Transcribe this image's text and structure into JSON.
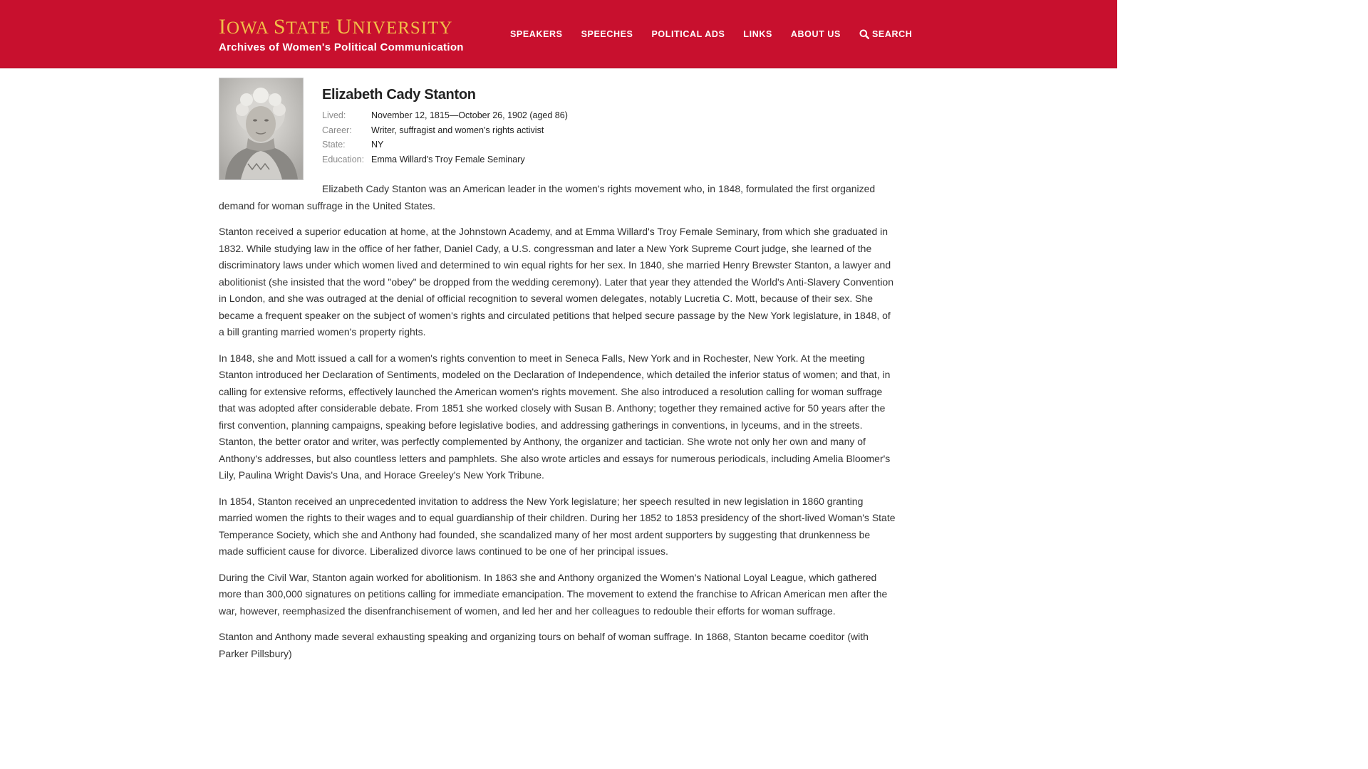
{
  "header": {
    "wordmark_i": "I",
    "wordmark_owa": "OWA",
    "wordmark_s": "S",
    "wordmark_tate": "TATE",
    "wordmark_u": "U",
    "wordmark_niversity": "NIVERSITY",
    "subtitle": "Archives of Women's Political Communication",
    "colors": {
      "bar": "#c8102e",
      "gold": "#f1be48"
    }
  },
  "nav": {
    "items": [
      "SPEAKERS",
      "SPEECHES",
      "POLITICAL ADS",
      "LINKS",
      "ABOUT US"
    ],
    "search_label": "SEARCH",
    "search_icon": "search-icon"
  },
  "profile": {
    "name": "Elizabeth Cady Stanton",
    "facts": [
      {
        "label": "Lived:",
        "value": "November 12, 1815—October 26, 1902 (aged 86)"
      },
      {
        "label": "Career:",
        "value": "Writer, suffragist and women's rights activist"
      },
      {
        "label": "State:",
        "value": "NY"
      },
      {
        "label": "Education:",
        "value": "Emma Willard's Troy Female Seminary"
      }
    ]
  },
  "bio": {
    "paragraphs": [
      "Elizabeth Cady Stanton was an American leader in the women's rights movement who, in 1848, formulated the first organized demand for woman suffrage in the United States.",
      "Stanton received a superior education at home, at the Johnstown Academy, and at Emma Willard's Troy Female Seminary, from which she graduated in 1832. While studying law in the office of her father, Daniel Cady, a U.S. congressman and later a New York Supreme Court judge, she learned of the discriminatory laws under which women lived and determined to win equal rights for her sex. In 1840, she married Henry Brewster Stanton, a lawyer and abolitionist (she insisted that the word \"obey\" be dropped from the wedding ceremony). Later that year they attended the World's Anti-Slavery Convention in London, and she was outraged at the denial of official recognition to several women delegates, notably Lucretia C. Mott, because of their sex. She became a frequent speaker on the subject of women's rights and circulated petitions that helped secure passage by the New York legislature, in 1848, of a bill granting married women's property rights.",
      "In 1848, she and Mott issued a call for a women's rights convention to meet in Seneca Falls, New York and in Rochester, New York. At the meeting Stanton introduced her Declaration of Sentiments, modeled on the Declaration of Independence, which detailed the inferior status of women; and that, in calling for extensive reforms, effectively launched the American women's rights movement. She also introduced a resolution calling for woman suffrage that was adopted after considerable debate. From 1851 she worked closely with Susan B. Anthony; together they remained active for 50 years after the first convention, planning campaigns, speaking before legislative bodies, and addressing gatherings in conventions, in lyceums, and in the streets. Stanton, the better orator and writer, was perfectly complemented by Anthony, the organizer and tactician. She wrote not only her own and many of Anthony's addresses, but also countless letters and pamphlets. She also wrote articles and essays for numerous periodicals, including Amelia Bloomer's Lily, Paulina Wright Davis's Una, and Horace Greeley's New York Tribune.",
      "In 1854, Stanton received an unprecedented invitation to address the New York legislature; her speech resulted in new legislation in 1860 granting married women the rights to their wages and to equal guardianship of their children. During her 1852 to 1853 presidency of the short-lived Woman's State Temperance Society, which she and Anthony had founded, she scandalized many of her most ardent supporters by suggesting that drunkenness be made sufficient cause for divorce. Liberalized divorce laws continued to be one of her principal issues.",
      "During the Civil War, Stanton again worked for abolitionism. In 1863 she and Anthony organized the Women's National Loyal League, which gathered more than 300,000 signatures on petitions calling for immediate emancipation. The movement to extend the franchise to African American men after the war, however, reemphasized the disenfranchisement of women, and led her and her colleagues to redouble their efforts for woman suffrage.",
      "Stanton and Anthony made several exhausting speaking and organizing tours on behalf of woman suffrage. In 1868, Stanton became coeditor (with Parker Pillsbury)"
    ]
  }
}
